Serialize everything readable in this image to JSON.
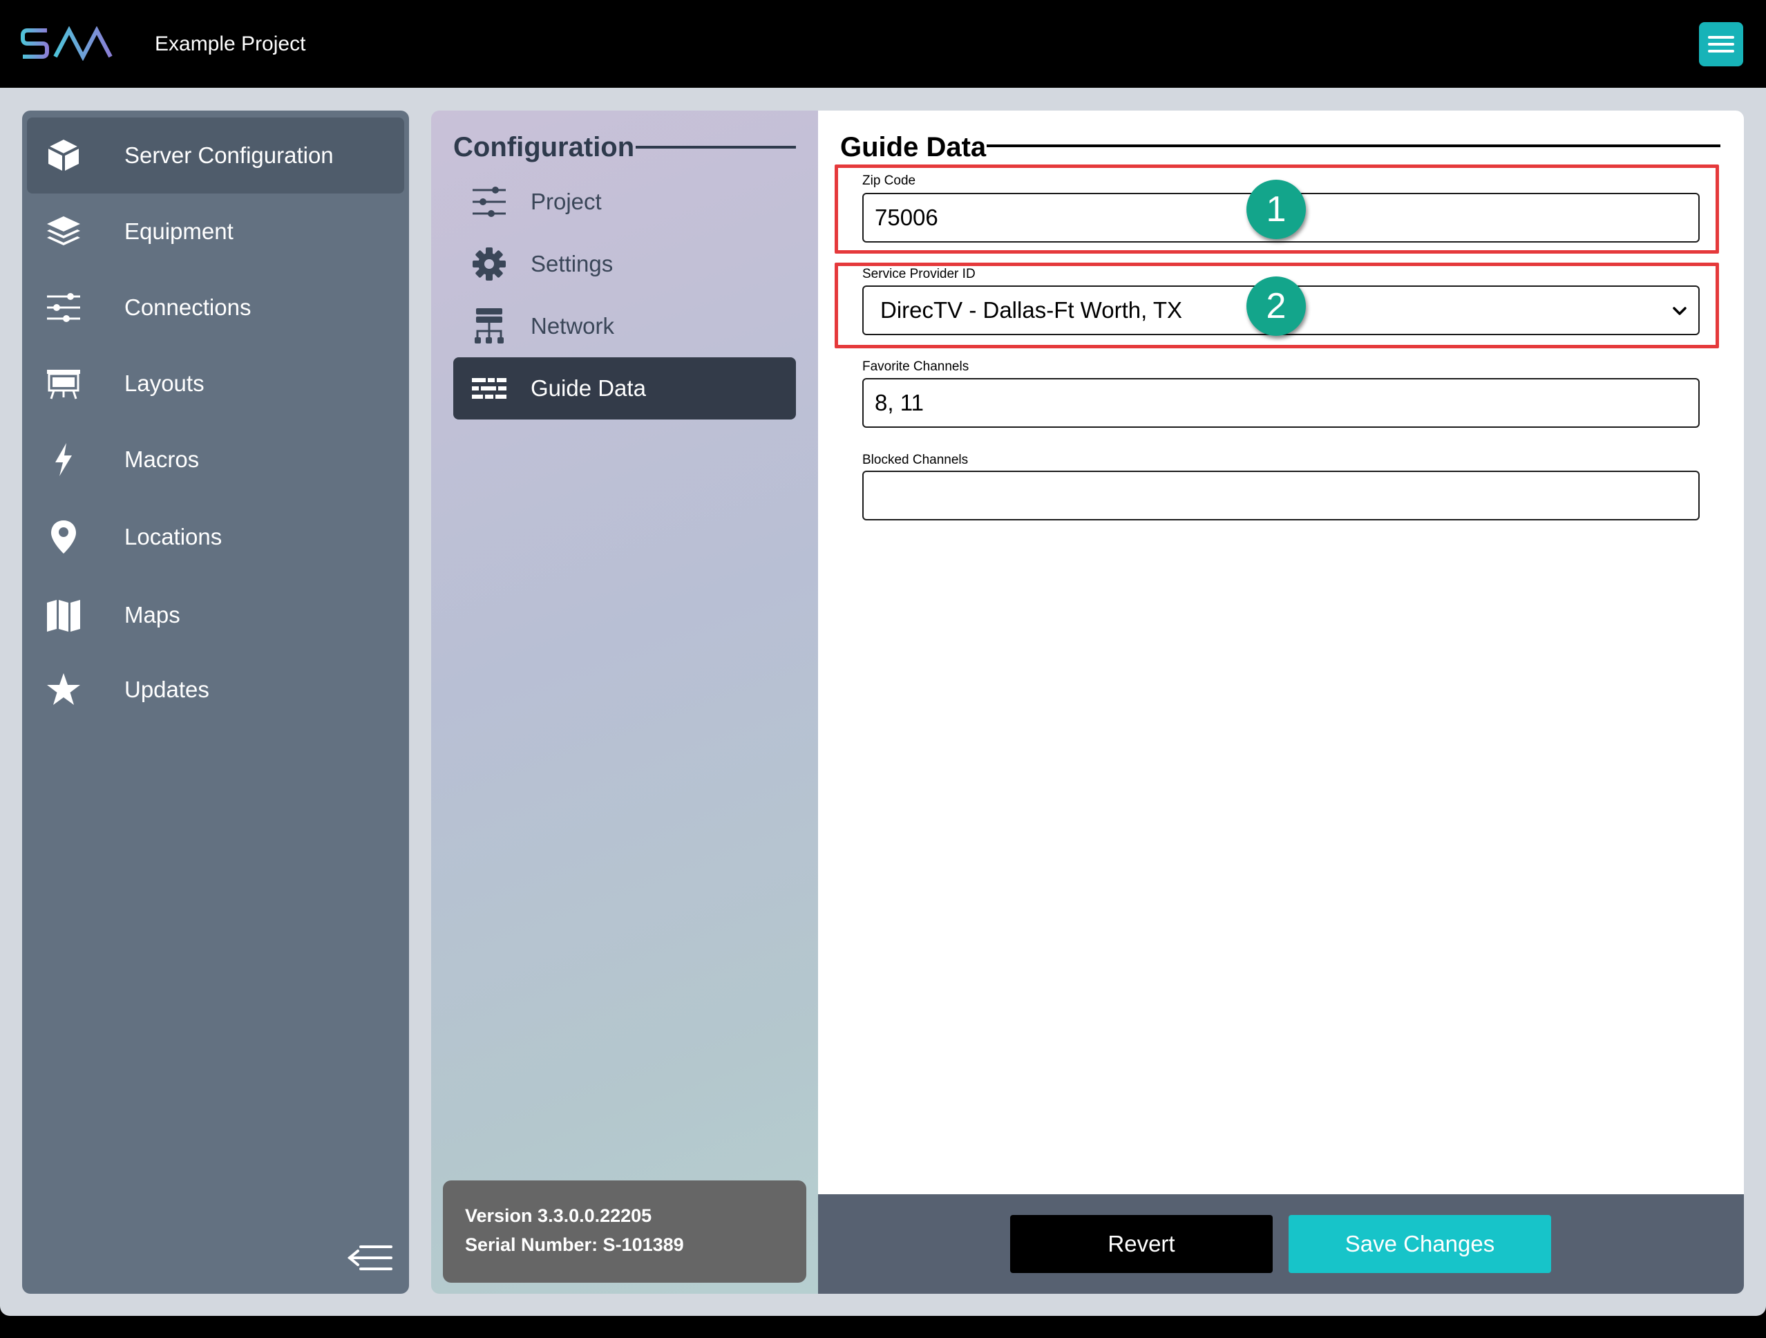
{
  "header": {
    "logo_text": "SAVI",
    "project_name": "Example Project"
  },
  "sidebar": {
    "items": [
      {
        "label": "Server Configuration",
        "icon": "cube-icon",
        "active": true
      },
      {
        "label": "Equipment",
        "icon": "layers-icon",
        "active": false
      },
      {
        "label": "Connections",
        "icon": "sliders-icon",
        "active": false
      },
      {
        "label": "Layouts",
        "icon": "presentation-board-icon",
        "active": false
      },
      {
        "label": "Macros",
        "icon": "lightning-icon",
        "active": false
      },
      {
        "label": "Locations",
        "icon": "map-pin-icon",
        "active": false
      },
      {
        "label": "Maps",
        "icon": "folded-map-icon",
        "active": false
      },
      {
        "label": "Updates",
        "icon": "star-icon",
        "active": false
      }
    ]
  },
  "config": {
    "title": "Configuration",
    "items": [
      {
        "label": "Project",
        "icon": "sliders-icon",
        "active": false
      },
      {
        "label": "Settings",
        "icon": "gear-icon",
        "active": false
      },
      {
        "label": "Network",
        "icon": "network-icon",
        "active": false
      },
      {
        "label": "Guide Data",
        "icon": "guide-grid-icon",
        "active": true
      }
    ],
    "version": "Version 3.3.0.0.22205",
    "serial": "Serial Number: S-101389"
  },
  "guide": {
    "title": "Guide Data",
    "zip_label": "Zip Code",
    "zip_value": "75006",
    "provider_label": "Service Provider ID",
    "provider_value": "DirecTV - Dallas-Ft Worth, TX",
    "favorites_label": "Favorite Channels",
    "favorites_value": "8, 11",
    "blocked_label": "Blocked Channels",
    "blocked_value": "",
    "badge_1": "1",
    "badge_2": "2"
  },
  "footer": {
    "revert_label": "Revert",
    "save_label": "Save Changes"
  },
  "colors": {
    "accent": "#17c4c9",
    "highlight": "#e5393b",
    "badge": "#13a58b",
    "sidebar": "#637181"
  }
}
